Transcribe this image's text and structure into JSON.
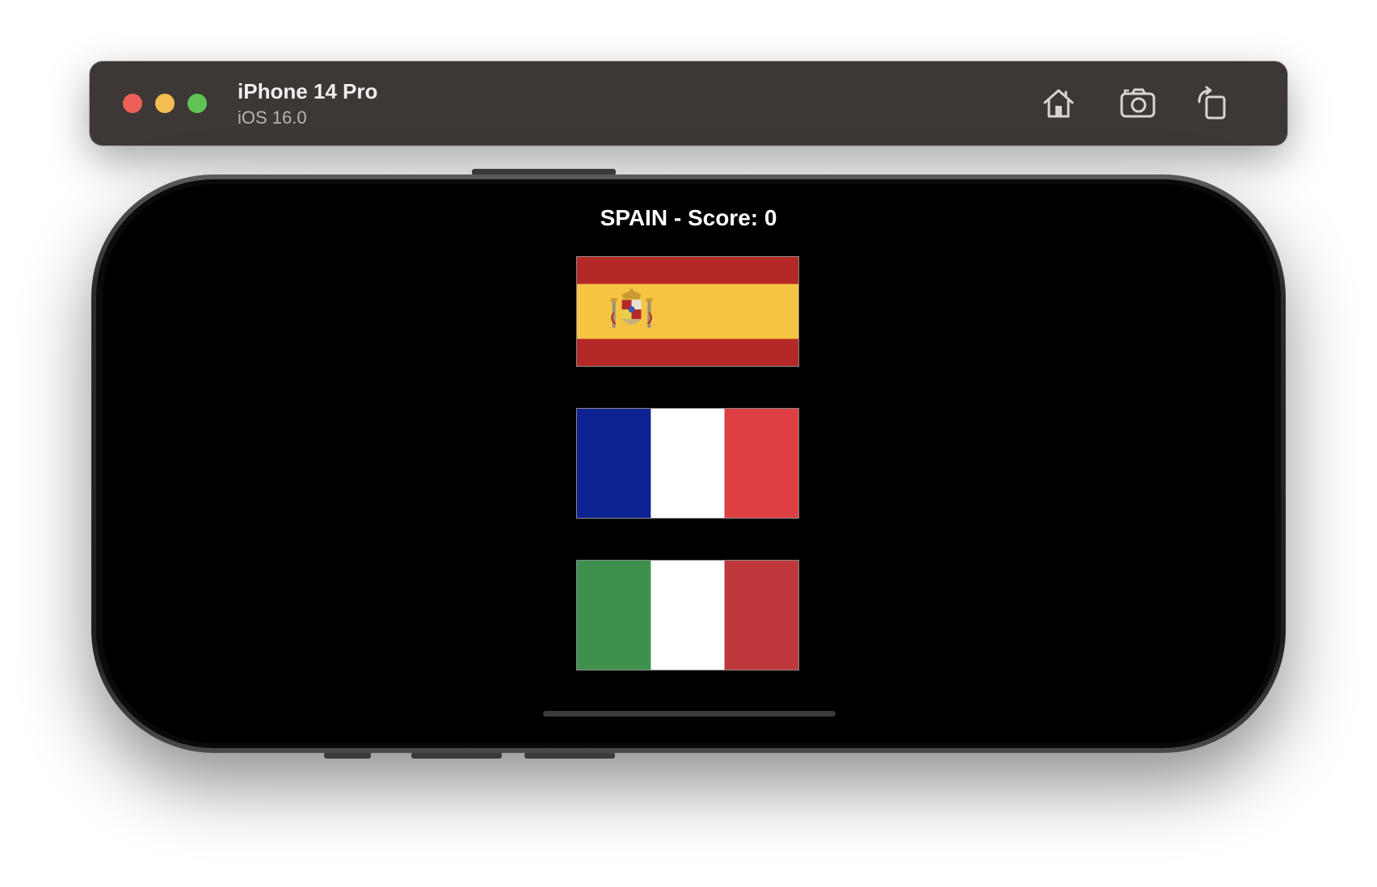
{
  "window": {
    "device_name": "iPhone 14 Pro",
    "os_version": "iOS 16.0",
    "toolbar_icons": [
      "home-icon",
      "screenshot-camera-icon",
      "rotate-icon"
    ],
    "traffic_lights": {
      "close": "#ee5f57",
      "minimize": "#f4bd4f",
      "zoom": "#5fc453"
    },
    "titlebar_color": "#3d3735"
  },
  "app": {
    "title": "SPAIN - Score: 0",
    "flags": [
      {
        "country": "spain",
        "colors": [
          "#b52828",
          "#f6c443",
          "#b52828"
        ]
      },
      {
        "country": "france",
        "colors": [
          "#0b2290",
          "#ffffff",
          "#dd3f42"
        ]
      },
      {
        "country": "italy",
        "colors": [
          "#3f904d",
          "#ffffff",
          "#bf393c"
        ]
      }
    ]
  }
}
